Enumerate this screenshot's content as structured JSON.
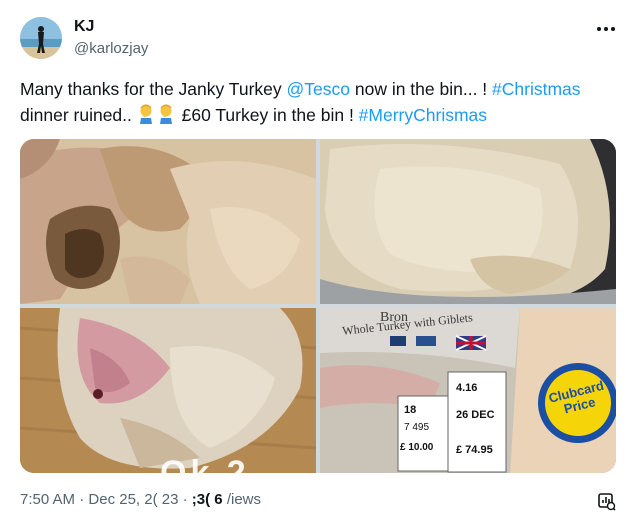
{
  "author": {
    "display_name": "KJ",
    "handle": "@karlozjay"
  },
  "tweet": {
    "segments": [
      {
        "text": "Many thanks for the Janky Turkey ",
        "type": "text"
      },
      {
        "text": "@Tesco",
        "type": "mention"
      },
      {
        "text": " now in the bin... ! ",
        "type": "text"
      },
      {
        "text": "#Christmas",
        "type": "hashtag"
      }
    ],
    "line2": [
      {
        "text": "dinner ruined.. ",
        "type": "text"
      },
      {
        "text": " £60 Turkey in the bin ! ",
        "type": "text"
      },
      {
        "text": "#MerryChrismas",
        "type": "hashtag"
      }
    ],
    "emoji": "person-facepalming"
  },
  "photos": [
    {
      "name": "turkey-photo-1"
    },
    {
      "name": "turkey-photo-2"
    },
    {
      "name": "turkey-photo-3"
    },
    {
      "name": "turkey-photo-4",
      "packaging": {
        "brand_line1": "Bron",
        "brand_line2": "Whole Turkey with Giblets",
        "clubcard_line1": "Clubcard",
        "clubcard_line2": "Price",
        "label_weight_kg": "4.16",
        "label_date": "26 DEC",
        "label_price": "£ 74.95",
        "label_price_left": "£ 10.00",
        "label_cook": "18",
        "label_num": "7 495"
      }
    }
  ],
  "meta": {
    "time": "7:50 AM",
    "sep1": " · ",
    "date": "Dec 25, 2(  23",
    "sep2": " · ",
    "views_count": ";3( 6",
    "views_label": "/iews"
  },
  "watermark": "Ok           2",
  "colors": {
    "link": "#1d9bf0",
    "text": "#0f1419",
    "muted": "#536471",
    "clubcard_yellow": "#f6d40a",
    "clubcard_blue": "#1b4fa3"
  }
}
